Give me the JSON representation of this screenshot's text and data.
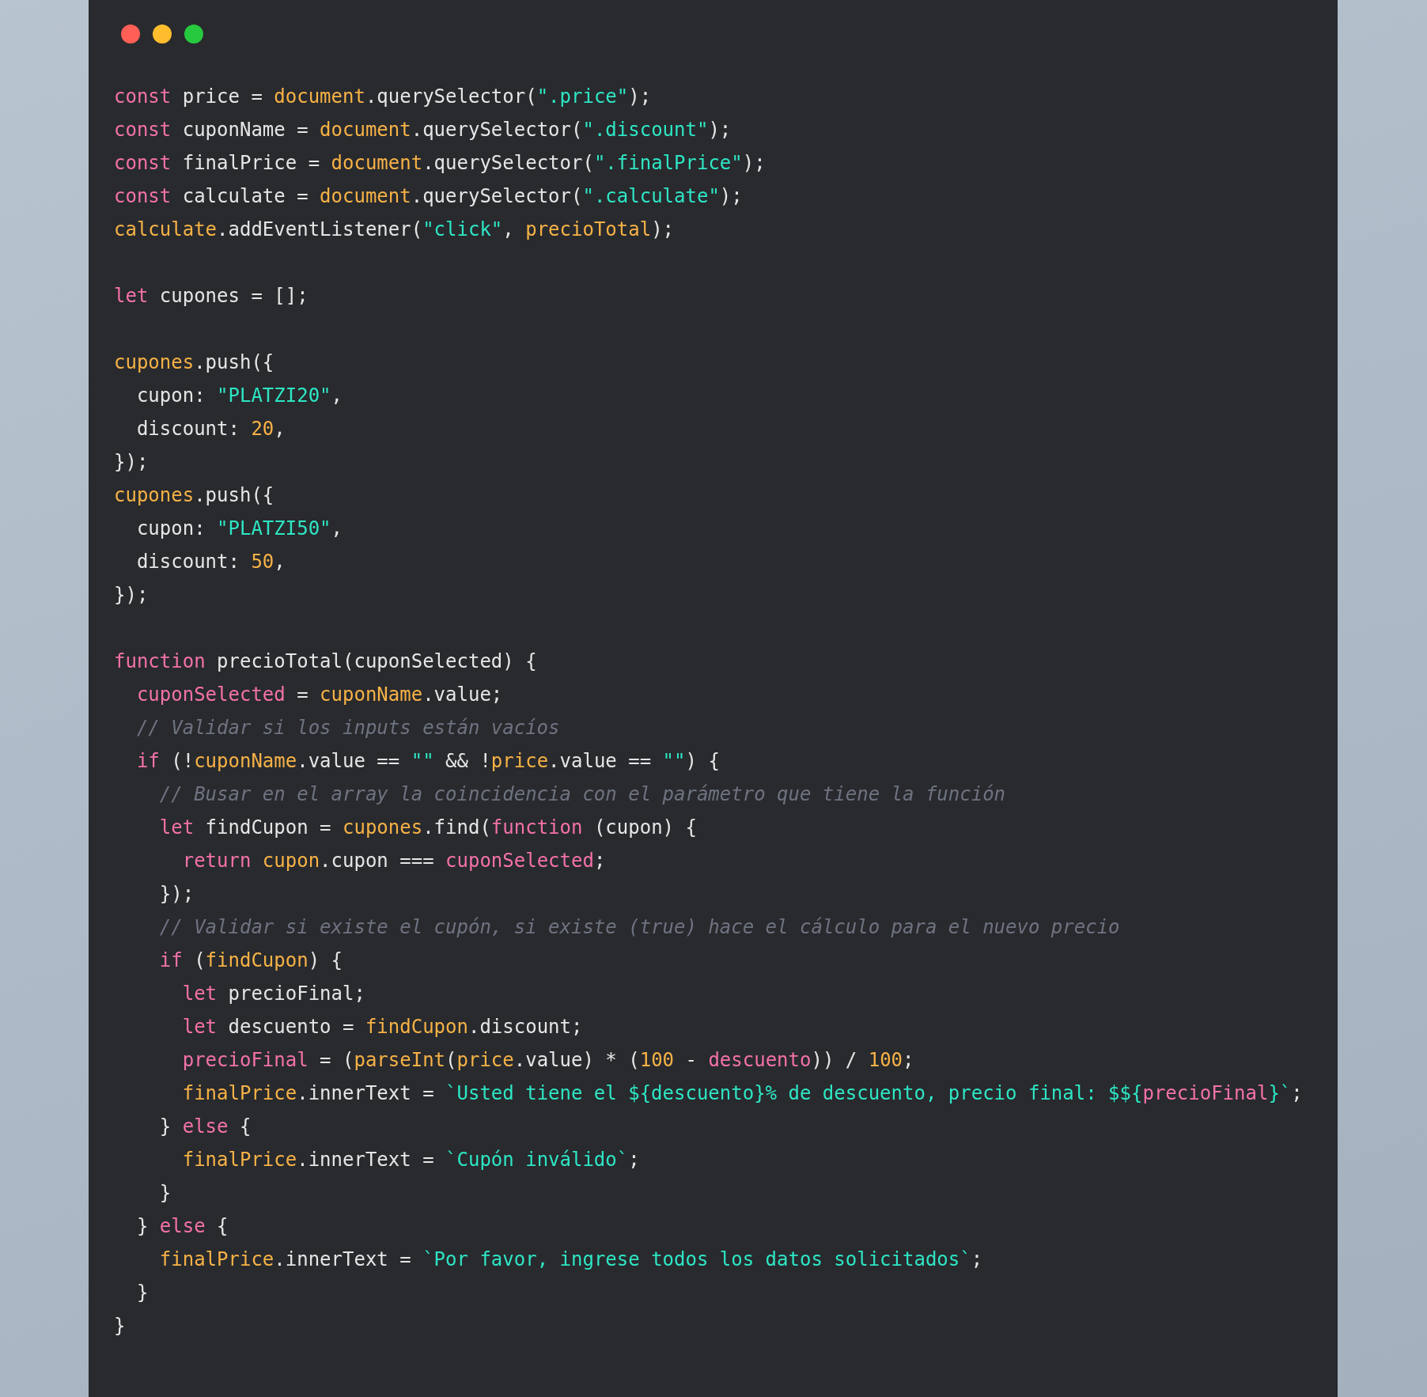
{
  "window": {
    "controls": [
      {
        "color": "#ff5f56"
      },
      {
        "color": "#ffbd2e"
      },
      {
        "color": "#27c93f"
      }
    ]
  },
  "code": {
    "blocks": [
      {
        "lines": [
          [
            {
              "kind": "kw",
              "text": "const"
            },
            {
              "kind": "txt",
              "text": " price = "
            },
            {
              "kind": "var",
              "text": "document"
            },
            {
              "kind": "txt",
              "text": ".querySelector("
            },
            {
              "kind": "str",
              "text": "\".price\""
            },
            {
              "kind": "txt",
              "text": ");"
            }
          ],
          [
            {
              "kind": "kw",
              "text": "const"
            },
            {
              "kind": "txt",
              "text": " cuponName = "
            },
            {
              "kind": "var",
              "text": "document"
            },
            {
              "kind": "txt",
              "text": ".querySelector("
            },
            {
              "kind": "str",
              "text": "\".discount\""
            },
            {
              "kind": "txt",
              "text": ");"
            }
          ],
          [
            {
              "kind": "kw",
              "text": "const"
            },
            {
              "kind": "txt",
              "text": " finalPrice = "
            },
            {
              "kind": "var",
              "text": "document"
            },
            {
              "kind": "txt",
              "text": ".querySelector("
            },
            {
              "kind": "str",
              "text": "\".finalPrice\""
            },
            {
              "kind": "txt",
              "text": ");"
            }
          ],
          [
            {
              "kind": "kw",
              "text": "const"
            },
            {
              "kind": "txt",
              "text": " calculate = "
            },
            {
              "kind": "var",
              "text": "document"
            },
            {
              "kind": "txt",
              "text": ".querySelector("
            },
            {
              "kind": "str",
              "text": "\".calculate\""
            },
            {
              "kind": "txt",
              "text": ");"
            }
          ],
          [
            {
              "kind": "var",
              "text": "calculate"
            },
            {
              "kind": "txt",
              "text": ".addEventListener("
            },
            {
              "kind": "str",
              "text": "\"click\""
            },
            {
              "kind": "txt",
              "text": ", "
            },
            {
              "kind": "var",
              "text": "precioTotal"
            },
            {
              "kind": "txt",
              "text": ");"
            }
          ]
        ]
      },
      {
        "lines": [
          [
            {
              "kind": "kw",
              "text": "let"
            },
            {
              "kind": "txt",
              "text": " cupones = [];"
            }
          ]
        ]
      },
      {
        "lines": [
          [
            {
              "kind": "var",
              "text": "cupones"
            },
            {
              "kind": "txt",
              "text": ".push({"
            }
          ],
          [
            {
              "kind": "txt",
              "text": "  cupon: "
            },
            {
              "kind": "str",
              "text": "\"PLATZI20\""
            },
            {
              "kind": "txt",
              "text": ","
            }
          ],
          [
            {
              "kind": "txt",
              "text": "  discount: "
            },
            {
              "kind": "num",
              "text": "20"
            },
            {
              "kind": "txt",
              "text": ","
            }
          ],
          [
            {
              "kind": "txt",
              "text": "});"
            }
          ],
          [
            {
              "kind": "var",
              "text": "cupones"
            },
            {
              "kind": "txt",
              "text": ".push({"
            }
          ],
          [
            {
              "kind": "txt",
              "text": "  cupon: "
            },
            {
              "kind": "str",
              "text": "\"PLATZI50\""
            },
            {
              "kind": "txt",
              "text": ","
            }
          ],
          [
            {
              "kind": "txt",
              "text": "  discount: "
            },
            {
              "kind": "num",
              "text": "50"
            },
            {
              "kind": "txt",
              "text": ","
            }
          ],
          [
            {
              "kind": "txt",
              "text": "});"
            }
          ]
        ]
      },
      {
        "lines": [
          [
            {
              "kind": "kw",
              "text": "function"
            },
            {
              "kind": "txt",
              "text": " precioTotal(cuponSelected) {"
            }
          ],
          [
            {
              "kind": "kw",
              "text": "  cuponSelected"
            },
            {
              "kind": "txt",
              "text": " = "
            },
            {
              "kind": "var",
              "text": "cuponName"
            },
            {
              "kind": "txt",
              "text": ".value;"
            }
          ],
          [
            {
              "kind": "com",
              "text": "  // Validar si los inputs están vacíos"
            }
          ],
          [
            {
              "kind": "kw",
              "text": "  if"
            },
            {
              "kind": "txt",
              "text": " (!"
            },
            {
              "kind": "var",
              "text": "cuponName"
            },
            {
              "kind": "txt",
              "text": ".value == "
            },
            {
              "kind": "str",
              "text": "\"\""
            },
            {
              "kind": "txt",
              "text": " && !"
            },
            {
              "kind": "var",
              "text": "price"
            },
            {
              "kind": "txt",
              "text": ".value == "
            },
            {
              "kind": "str",
              "text": "\"\""
            },
            {
              "kind": "txt",
              "text": ") {"
            }
          ],
          [
            {
              "kind": "com",
              "text": "    // Busar en el array la coincidencia con el parámetro que tiene la función"
            }
          ],
          [
            {
              "kind": "kw",
              "text": "    let"
            },
            {
              "kind": "txt",
              "text": " findCupon = "
            },
            {
              "kind": "var",
              "text": "cupones"
            },
            {
              "kind": "txt",
              "text": ".find("
            },
            {
              "kind": "kw",
              "text": "function"
            },
            {
              "kind": "txt",
              "text": " (cupon) {"
            }
          ],
          [
            {
              "kind": "kw",
              "text": "      return"
            },
            {
              "kind": "var",
              "text": " cupon"
            },
            {
              "kind": "txt",
              "text": ".cupon === "
            },
            {
              "kind": "kw",
              "text": "cuponSelected"
            },
            {
              "kind": "txt",
              "text": ";"
            }
          ],
          [
            {
              "kind": "txt",
              "text": "    });"
            }
          ],
          [
            {
              "kind": "com",
              "text": "    // Validar si existe el cupón, si existe (true) hace el cálculo para el nuevo precio"
            }
          ],
          [
            {
              "kind": "kw",
              "text": "    if"
            },
            {
              "kind": "txt",
              "text": " ("
            },
            {
              "kind": "var",
              "text": "findCupon"
            },
            {
              "kind": "txt",
              "text": ") {"
            }
          ],
          [
            {
              "kind": "kw",
              "text": "      let"
            },
            {
              "kind": "txt",
              "text": " precioFinal;"
            }
          ],
          [
            {
              "kind": "kw",
              "text": "      let"
            },
            {
              "kind": "txt",
              "text": " descuento = "
            },
            {
              "kind": "var",
              "text": "findCupon"
            },
            {
              "kind": "txt",
              "text": ".discount;"
            }
          ],
          [
            {
              "kind": "kw",
              "text": "      precioFinal"
            },
            {
              "kind": "txt",
              "text": " = ("
            },
            {
              "kind": "var",
              "text": "parseInt"
            },
            {
              "kind": "txt",
              "text": "("
            },
            {
              "kind": "var",
              "text": "price"
            },
            {
              "kind": "txt",
              "text": ".value) * ("
            },
            {
              "kind": "num",
              "text": "100"
            },
            {
              "kind": "txt",
              "text": " - "
            },
            {
              "kind": "kw",
              "text": "descuento"
            },
            {
              "kind": "txt",
              "text": ")) / "
            },
            {
              "kind": "num",
              "text": "100"
            },
            {
              "kind": "txt",
              "text": ";"
            }
          ],
          [
            {
              "kind": "var",
              "text": "      finalPrice"
            },
            {
              "kind": "txt",
              "text": ".innerText = "
            },
            {
              "kind": "str",
              "text": "`Usted tiene el ${descuento}% de descuento, precio final: $${"
            },
            {
              "kind": "kw",
              "text": "precioFinal"
            },
            {
              "kind": "str",
              "text": "}`"
            },
            {
              "kind": "txt",
              "text": ";"
            }
          ],
          [
            {
              "kind": "txt",
              "text": "    } "
            },
            {
              "kind": "kw",
              "text": "else"
            },
            {
              "kind": "txt",
              "text": " {"
            }
          ],
          [
            {
              "kind": "var",
              "text": "      finalPrice"
            },
            {
              "kind": "txt",
              "text": ".innerText = "
            },
            {
              "kind": "str",
              "text": "`Cupón inválido`"
            },
            {
              "kind": "txt",
              "text": ";"
            }
          ],
          [
            {
              "kind": "txt",
              "text": "    }"
            }
          ],
          [
            {
              "kind": "txt",
              "text": "  } "
            },
            {
              "kind": "kw",
              "text": "else"
            },
            {
              "kind": "txt",
              "text": " {"
            }
          ],
          [
            {
              "kind": "var",
              "text": "    finalPrice"
            },
            {
              "kind": "txt",
              "text": ".innerText = "
            },
            {
              "kind": "str",
              "text": "`Por favor, ingrese todos los datos solicitados`"
            },
            {
              "kind": "txt",
              "text": ";"
            }
          ],
          [
            {
              "kind": "txt",
              "text": "  }"
            }
          ],
          [
            {
              "kind": "txt",
              "text": "}"
            }
          ]
        ]
      }
    ]
  }
}
